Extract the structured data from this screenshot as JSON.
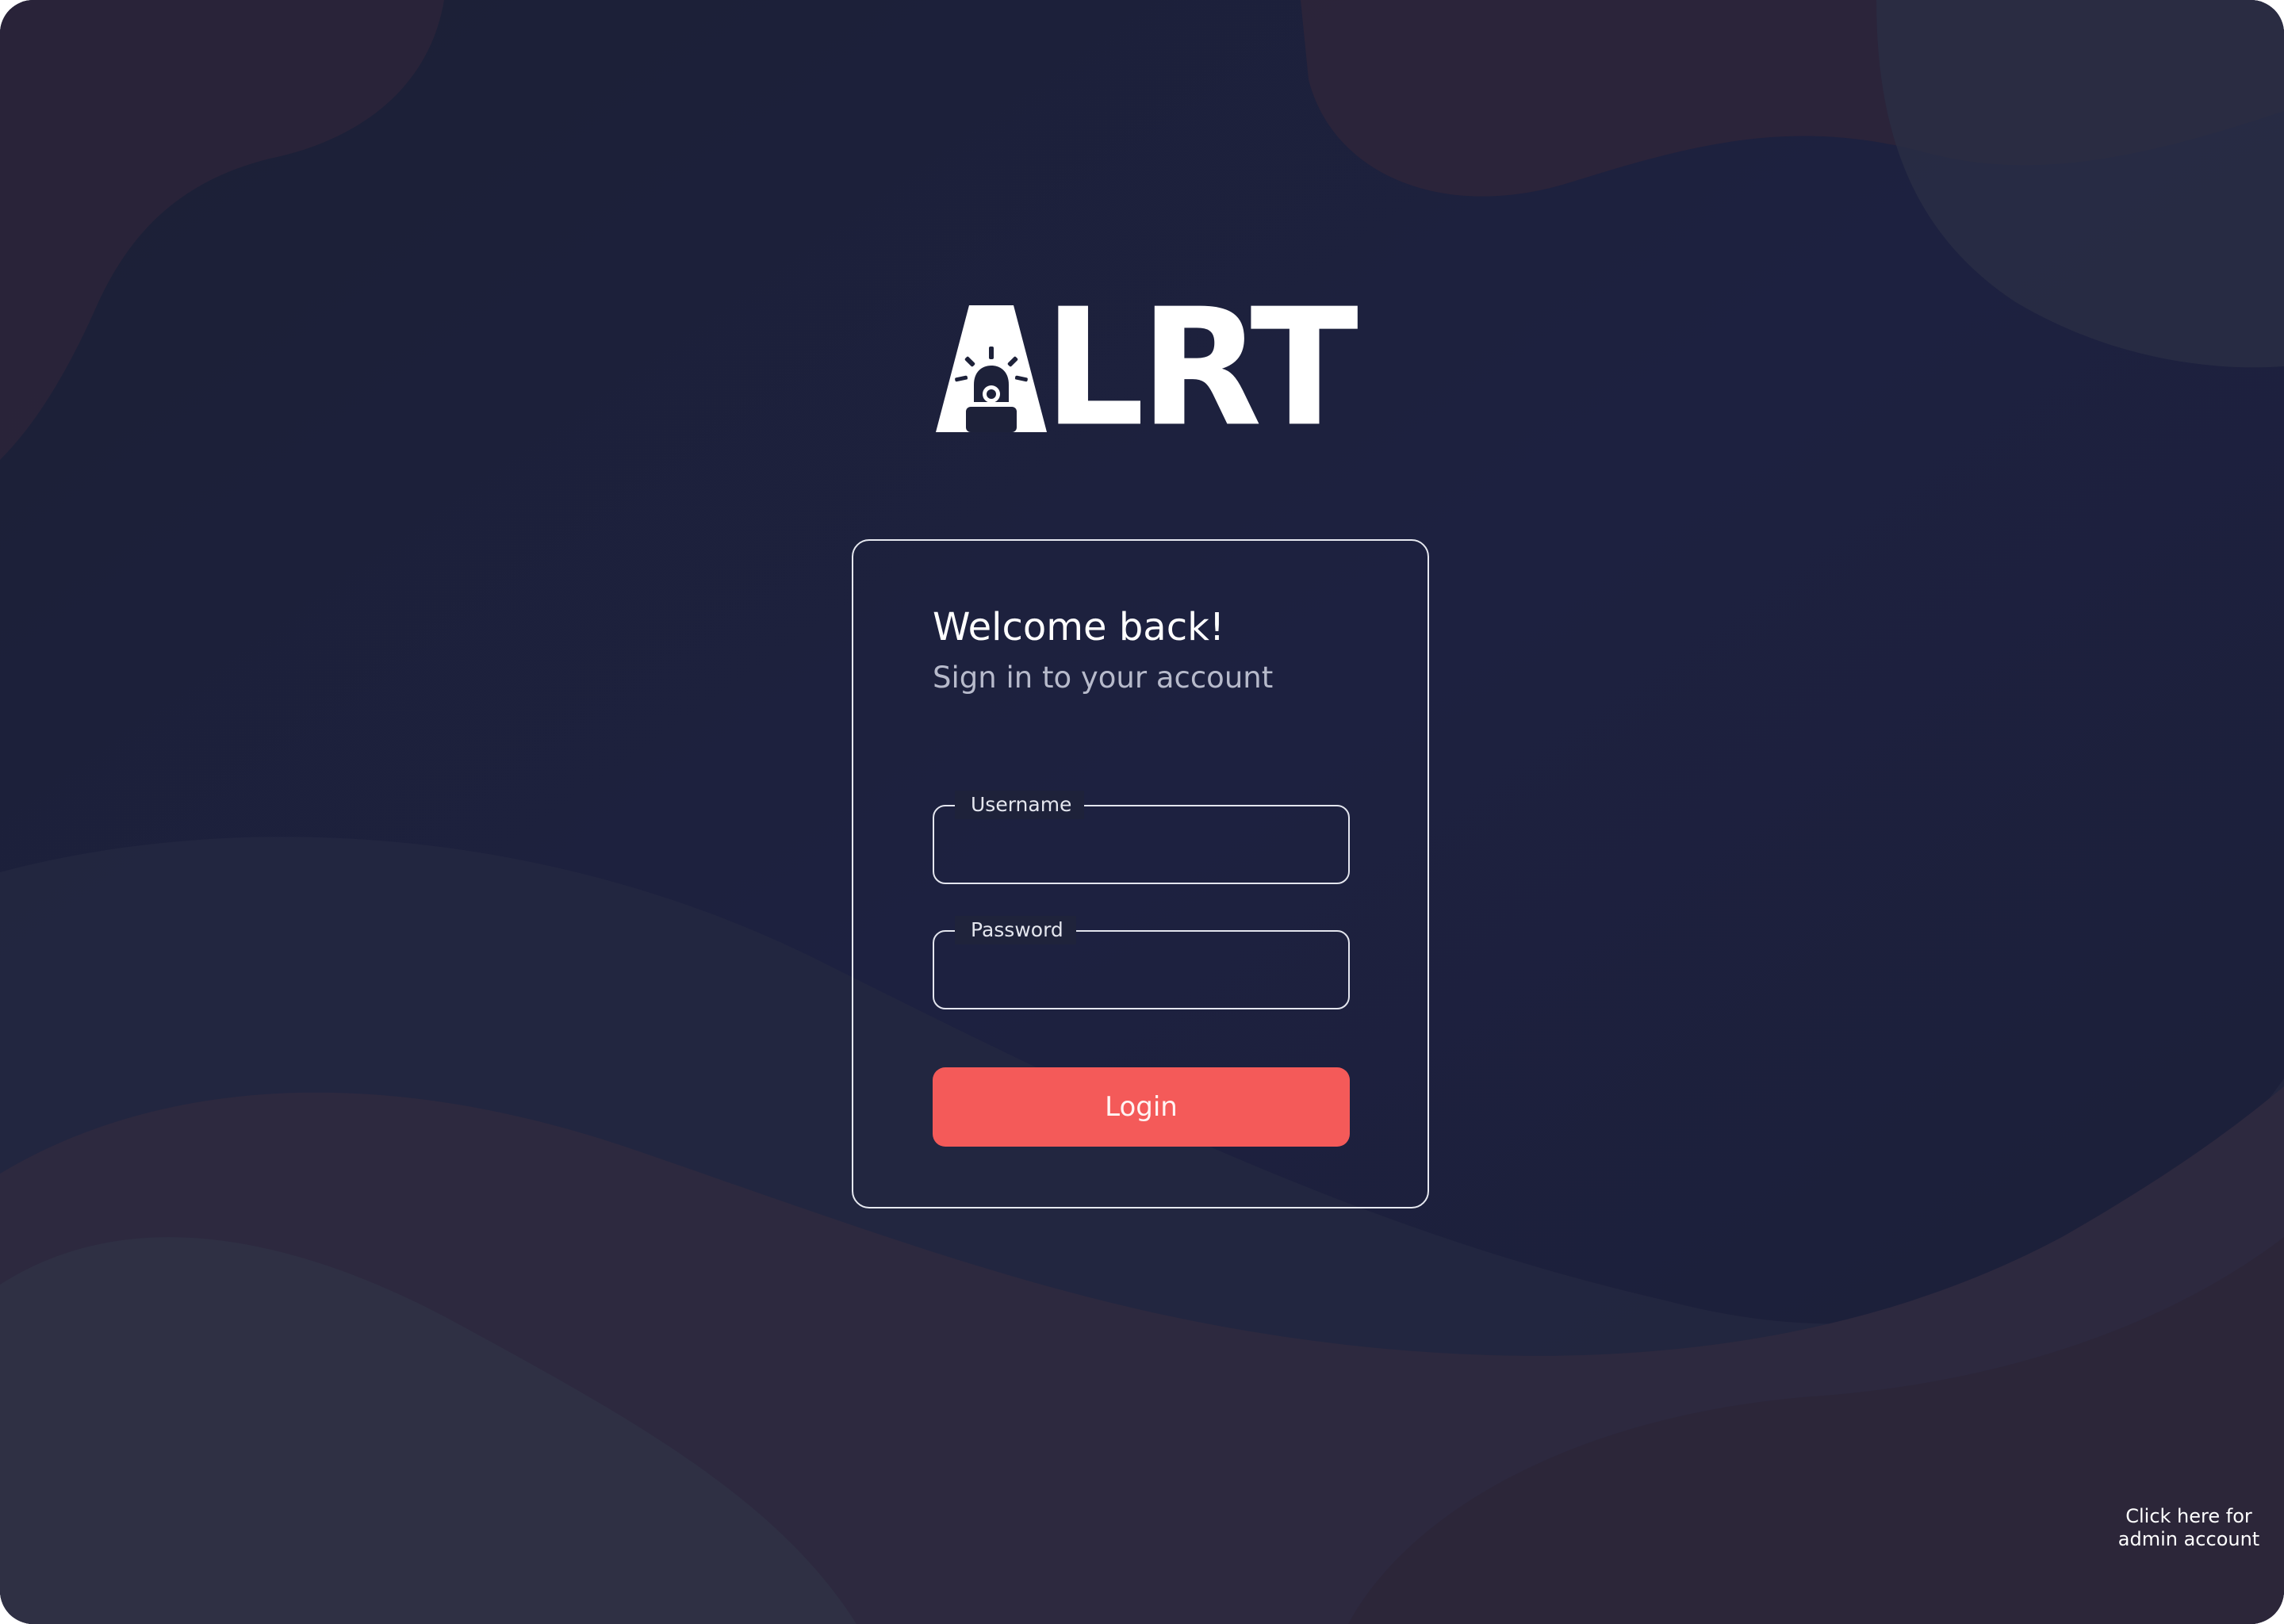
{
  "app": {
    "logo_text": "LRT"
  },
  "login": {
    "heading": "Welcome back!",
    "subheading": "Sign in to your account",
    "username_label": "Username",
    "username_value": "",
    "password_label": "Password",
    "password_value": "",
    "login_button": "Login"
  },
  "admin_link": {
    "line1": "Click here for",
    "line2": "admin account"
  },
  "colors": {
    "background": "#1d2139",
    "accent": "#f45a59",
    "text": "#ffffff",
    "subtext": "#b7bacb"
  },
  "icons": [
    "siren-icon"
  ]
}
